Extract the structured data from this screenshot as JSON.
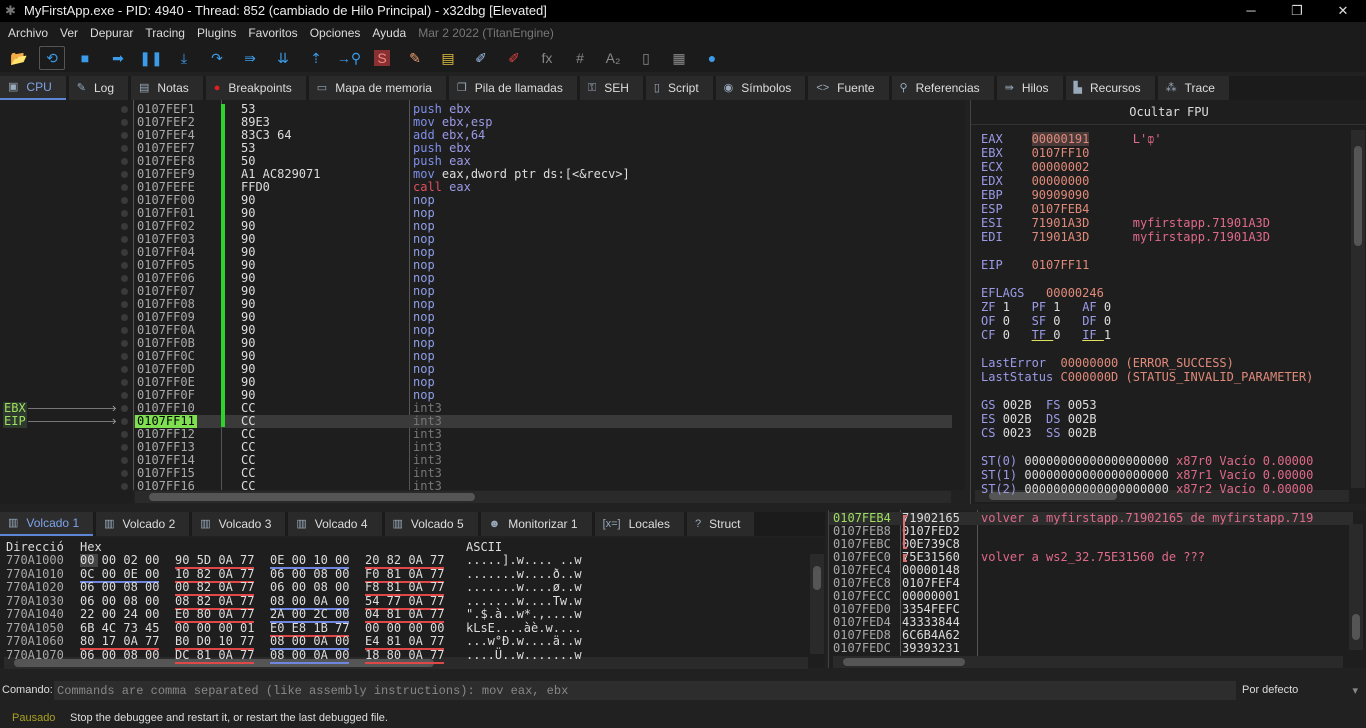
{
  "window": {
    "title": "MyFirstApp.exe - PID: 4940 - Thread: 852 (cambiado de Hilo Principal) - x32dbg [Elevated]",
    "minimize": "─",
    "maximize": "❐",
    "close": "✕"
  },
  "menu": {
    "items": [
      "Archivo",
      "Ver",
      "Depurar",
      "Tracing",
      "Plugins",
      "Favoritos",
      "Opciones",
      "Ayuda"
    ],
    "version": "Mar 2 2022 (TitanEngine)"
  },
  "toolbar": [
    {
      "icon": "open-folder-icon",
      "glyph": "📂"
    },
    {
      "icon": "restart-icon",
      "glyph": "⟲",
      "selected": true
    },
    {
      "icon": "stop-icon",
      "glyph": "■"
    },
    {
      "icon": "run-icon",
      "glyph": "➡"
    },
    {
      "icon": "pause-icon",
      "glyph": "❚❚"
    },
    {
      "icon": "step-into-icon",
      "glyph": "⤓"
    },
    {
      "icon": "step-over-icon",
      "glyph": "↷"
    },
    {
      "icon": "trace-into-icon",
      "glyph": "⇛"
    },
    {
      "icon": "trace-over-icon",
      "glyph": "⇊"
    },
    {
      "icon": "execute-till-return-icon",
      "glyph": "⇡"
    },
    {
      "icon": "run-to-user-code-icon",
      "glyph": "→⚲"
    },
    {
      "icon": "scylla-icon",
      "glyph": "S"
    },
    {
      "icon": "patch-icon",
      "glyph": "✎"
    },
    {
      "icon": "comments-icon",
      "glyph": "▤"
    },
    {
      "icon": "labels-icon",
      "glyph": "✐"
    },
    {
      "icon": "bookmarks-icon",
      "glyph": "✐"
    },
    {
      "icon": "functions-icon",
      "glyph": "fx"
    },
    {
      "icon": "hash-icon",
      "glyph": "#"
    },
    {
      "icon": "strings-icon",
      "glyph": "A₂"
    },
    {
      "icon": "device-icon",
      "glyph": "▯"
    },
    {
      "icon": "calculator-icon",
      "glyph": "▦"
    },
    {
      "icon": "globe-icon",
      "glyph": "●"
    }
  ],
  "tabs": [
    {
      "label": "CPU",
      "icon": "cpu-icon",
      "glyph": "▣",
      "active": true
    },
    {
      "label": "Log",
      "icon": "log-icon",
      "glyph": "✎"
    },
    {
      "label": "Notas",
      "icon": "notes-icon",
      "glyph": "▤"
    },
    {
      "label": "Breakpoints",
      "icon": "breakpoint-icon",
      "glyph": "●"
    },
    {
      "label": "Mapa de memoria",
      "icon": "memory-map-icon",
      "glyph": "▭"
    },
    {
      "label": "Pila de llamadas",
      "icon": "call-stack-icon",
      "glyph": "❐"
    },
    {
      "label": "SEH",
      "icon": "seh-icon",
      "glyph": "⚿"
    },
    {
      "label": "Script",
      "icon": "script-icon",
      "glyph": "▯"
    },
    {
      "label": "Símbolos",
      "icon": "symbols-icon",
      "glyph": "◉"
    },
    {
      "label": "Fuente",
      "icon": "source-icon",
      "glyph": "<>"
    },
    {
      "label": "Referencias",
      "icon": "references-icon",
      "glyph": "⚲"
    },
    {
      "label": "Hilos",
      "icon": "threads-icon",
      "glyph": "⇛"
    },
    {
      "label": "Recursos",
      "icon": "resources-icon",
      "glyph": "▙"
    },
    {
      "label": "Trace",
      "icon": "trace-icon",
      "glyph": "⁂"
    }
  ],
  "disasm": {
    "labels": [
      {
        "text": "EBX",
        "row": 23
      },
      {
        "text": "EIP",
        "row": 24
      }
    ],
    "current_row": 24,
    "rows": [
      {
        "addr": "0107FEF1",
        "bytes": "53",
        "mn": "push",
        "op": "ebx"
      },
      {
        "addr": "0107FEF2",
        "bytes": "89E3",
        "mn": "mov",
        "op": "ebx,esp"
      },
      {
        "addr": "0107FEF4",
        "bytes": "83C3 64",
        "mn": "add",
        "op": "ebx,64"
      },
      {
        "addr": "0107FEF7",
        "bytes": "53",
        "mn": "push",
        "op": "ebx"
      },
      {
        "addr": "0107FEF8",
        "bytes": "50",
        "mn": "push",
        "op": "eax"
      },
      {
        "addr": "0107FEF9",
        "bytes": "A1 AC829071",
        "mn": "mov",
        "op": "eax,dword ptr ds:[<&recv>]"
      },
      {
        "addr": "0107FEFE",
        "bytes": "FFD0",
        "mn": "call",
        "op": "eax"
      },
      {
        "addr": "0107FF00",
        "bytes": "90",
        "mn": "nop",
        "op": ""
      },
      {
        "addr": "0107FF01",
        "bytes": "90",
        "mn": "nop",
        "op": ""
      },
      {
        "addr": "0107FF02",
        "bytes": "90",
        "mn": "nop",
        "op": ""
      },
      {
        "addr": "0107FF03",
        "bytes": "90",
        "mn": "nop",
        "op": ""
      },
      {
        "addr": "0107FF04",
        "bytes": "90",
        "mn": "nop",
        "op": ""
      },
      {
        "addr": "0107FF05",
        "bytes": "90",
        "mn": "nop",
        "op": ""
      },
      {
        "addr": "0107FF06",
        "bytes": "90",
        "mn": "nop",
        "op": ""
      },
      {
        "addr": "0107FF07",
        "bytes": "90",
        "mn": "nop",
        "op": ""
      },
      {
        "addr": "0107FF08",
        "bytes": "90",
        "mn": "nop",
        "op": ""
      },
      {
        "addr": "0107FF09",
        "bytes": "90",
        "mn": "nop",
        "op": ""
      },
      {
        "addr": "0107FF0A",
        "bytes": "90",
        "mn": "nop",
        "op": ""
      },
      {
        "addr": "0107FF0B",
        "bytes": "90",
        "mn": "nop",
        "op": ""
      },
      {
        "addr": "0107FF0C",
        "bytes": "90",
        "mn": "nop",
        "op": ""
      },
      {
        "addr": "0107FF0D",
        "bytes": "90",
        "mn": "nop",
        "op": ""
      },
      {
        "addr": "0107FF0E",
        "bytes": "90",
        "mn": "nop",
        "op": ""
      },
      {
        "addr": "0107FF0F",
        "bytes": "90",
        "mn": "nop",
        "op": ""
      },
      {
        "addr": "0107FF10",
        "bytes": "CC",
        "mn": "int3",
        "op": ""
      },
      {
        "addr": "0107FF11",
        "bytes": "CC",
        "mn": "int3",
        "op": ""
      },
      {
        "addr": "0107FF12",
        "bytes": "CC",
        "mn": "int3",
        "op": ""
      },
      {
        "addr": "0107FF13",
        "bytes": "CC",
        "mn": "int3",
        "op": ""
      },
      {
        "addr": "0107FF14",
        "bytes": "CC",
        "mn": "int3",
        "op": ""
      },
      {
        "addr": "0107FF15",
        "bytes": "CC",
        "mn": "int3",
        "op": ""
      },
      {
        "addr": "0107FF16",
        "bytes": "CC",
        "mn": "int3",
        "op": ""
      }
    ]
  },
  "registers": {
    "fpu_toggle": "Ocultar FPU",
    "lines": [
      [
        [
          "EAX    ",
          "rn"
        ],
        [
          "00000191",
          "rv"
        ],
        [
          "      L'ȹ'",
          "rc"
        ]
      ],
      [
        [
          "EBX    ",
          "rn"
        ],
        [
          "0107FF10",
          "rv"
        ]
      ],
      [
        [
          "ECX    ",
          "rn"
        ],
        [
          "00000002",
          "rv"
        ]
      ],
      [
        [
          "EDX    ",
          "rn"
        ],
        [
          "00000000",
          "rv"
        ]
      ],
      [
        [
          "EBP    ",
          "rn"
        ],
        [
          "90909090",
          "rv"
        ]
      ],
      [
        [
          "ESP    ",
          "rn"
        ],
        [
          "0107FEB4",
          "rv"
        ]
      ],
      [
        [
          "ESI    ",
          "rn"
        ],
        [
          "71901A3D",
          "rv"
        ],
        [
          "      myfirstapp.71901A3D",
          "rc"
        ]
      ],
      [
        [
          "EDI    ",
          "rn"
        ],
        [
          "71901A3D",
          "rv"
        ],
        [
          "      myfirstapp.71901A3D",
          "rc"
        ]
      ],
      [],
      [
        [
          "EIP    ",
          "rn"
        ],
        [
          "0107FF11",
          "rv"
        ]
      ],
      [],
      [
        [
          "EFLAGS   ",
          "rn"
        ],
        [
          "00000246",
          "rv"
        ]
      ],
      [
        [
          "ZF ",
          "rn"
        ],
        [
          "1   ",
          "rw"
        ],
        [
          "PF ",
          "rn"
        ],
        [
          "1   ",
          "rw"
        ],
        [
          "AF ",
          "rn"
        ],
        [
          "0",
          "rw"
        ]
      ],
      [
        [
          "OF ",
          "rn"
        ],
        [
          "0   ",
          "rw"
        ],
        [
          "SF ",
          "rn"
        ],
        [
          "0   ",
          "rw"
        ],
        [
          "DF ",
          "rn"
        ],
        [
          "0",
          "rw"
        ]
      ],
      [
        [
          "CF ",
          "rn"
        ],
        [
          "0   ",
          "rw"
        ],
        [
          "TF ",
          "rn"
        ],
        [
          "0   ",
          "rw"
        ],
        [
          "IF ",
          "rn"
        ],
        [
          "1",
          "rw"
        ]
      ],
      [],
      [
        [
          "LastError  ",
          "rn"
        ],
        [
          "00000000 (ERROR_SUCCESS)",
          "rv"
        ]
      ],
      [
        [
          "LastStatus ",
          "rn"
        ],
        [
          "C000000D (STATUS_INVALID_PARAMETER)",
          "rv"
        ]
      ],
      [],
      [
        [
          "GS ",
          "rn"
        ],
        [
          "002B  ",
          "rw"
        ],
        [
          "FS ",
          "rn"
        ],
        [
          "0053",
          "rw"
        ]
      ],
      [
        [
          "ES ",
          "rn"
        ],
        [
          "002B  ",
          "rw"
        ],
        [
          "DS ",
          "rn"
        ],
        [
          "002B",
          "rw"
        ]
      ],
      [
        [
          "CS ",
          "rn"
        ],
        [
          "0023  ",
          "rw"
        ],
        [
          "SS ",
          "rn"
        ],
        [
          "002B",
          "rw"
        ]
      ],
      [],
      [
        [
          "ST(0) ",
          "rn"
        ],
        [
          "00000000000000000000 ",
          "rw"
        ],
        [
          "x87r0 Vacío 0.00000",
          "rc"
        ]
      ],
      [
        [
          "ST(1) ",
          "rn"
        ],
        [
          "00000000000000000000 ",
          "rw"
        ],
        [
          "x87r1 Vacío 0.00000",
          "rc"
        ]
      ],
      [
        [
          "ST(2) ",
          "rn"
        ],
        [
          "00000000000000000000 ",
          "rw"
        ],
        [
          "x87r2 Vacío 0.00000",
          "rc"
        ]
      ]
    ]
  },
  "bottom_tabs": [
    {
      "label": "Volcado 1",
      "icon": "dump-icon",
      "glyph": "▥",
      "active": true
    },
    {
      "label": "Volcado 2",
      "icon": "dump-icon",
      "glyph": "▥"
    },
    {
      "label": "Volcado 3",
      "icon": "dump-icon",
      "glyph": "▥"
    },
    {
      "label": "Volcado 4",
      "icon": "dump-icon",
      "glyph": "▥"
    },
    {
      "label": "Volcado 5",
      "icon": "dump-icon",
      "glyph": "▥"
    },
    {
      "label": "Monitorizar 1",
      "icon": "watch-icon",
      "glyph": "☻"
    },
    {
      "label": "Locales",
      "icon": "locals-icon",
      "glyph": "[x=]"
    },
    {
      "label": "Struct",
      "icon": "struct-icon",
      "glyph": "?"
    }
  ],
  "dump": {
    "headers": {
      "address": "Direcció",
      "hex": "Hex",
      "ascii": "ASCII"
    },
    "rows": [
      {
        "addr": "770A1000",
        "groups": [
          [
            "00 00 02 00",
            ""
          ],
          [
            "90 5D 0A 77",
            "red"
          ],
          [
            "0E 00 10 00",
            "blue"
          ],
          [
            "20 82 0A 77",
            "red"
          ]
        ],
        "ascii": ".....].w.... ..w"
      },
      {
        "addr": "770A1010",
        "groups": [
          [
            "0C 00 0E 00",
            "blue"
          ],
          [
            "10 82 0A 77",
            "red"
          ],
          [
            "06 00 08 00",
            ""
          ],
          [
            "F0 81 0A 77",
            "red"
          ]
        ],
        "ascii": ".......w....ð..w"
      },
      {
        "addr": "770A1020",
        "groups": [
          [
            "06 00 08 00",
            ""
          ],
          [
            "00 82 0A 77",
            "red"
          ],
          [
            "06 00 08 00",
            ""
          ],
          [
            "F8 81 0A 77",
            "red"
          ]
        ],
        "ascii": ".......w....ø..w"
      },
      {
        "addr": "770A1030",
        "groups": [
          [
            "06 00 08 00",
            ""
          ],
          [
            "08 82 0A 77",
            "red"
          ],
          [
            "08 00 0A 00",
            "blue"
          ],
          [
            "54 77 0A 77",
            "red"
          ]
        ],
        "ascii": ".......w....Tw.w"
      },
      {
        "addr": "770A1040",
        "groups": [
          [
            "22 00 24 00",
            ""
          ],
          [
            "E0 80 0A 77",
            "red"
          ],
          [
            "2A 00 2C 00",
            "blue"
          ],
          [
            "04 81 0A 77",
            "red"
          ]
        ],
        "ascii": "\".$.à..w*.,....w"
      },
      {
        "addr": "770A1050",
        "groups": [
          [
            "6B 4C 73 45",
            ""
          ],
          [
            "00 00 00 01",
            ""
          ],
          [
            "E0 E8 1B 77",
            "red"
          ],
          [
            "00 00 00 00",
            ""
          ]
        ],
        "ascii": "kLsE....àè.w...."
      },
      {
        "addr": "770A1060",
        "groups": [
          [
            "80 17 0A 77",
            "red"
          ],
          [
            "B0 D0 10 77",
            "red"
          ],
          [
            "08 00 0A 00",
            "blue"
          ],
          [
            "E4 81 0A 77",
            "red"
          ]
        ],
        "ascii": "...w°Đ.w....ä..w"
      },
      {
        "addr": "770A1070",
        "groups": [
          [
            "06 00 08 00",
            ""
          ],
          [
            "DC 81 0A 77",
            "red"
          ],
          [
            "08 00 0A 00",
            "blue"
          ],
          [
            "18 80 0A 77",
            "red"
          ]
        ],
        "ascii": "....Ü..w.......w"
      }
    ]
  },
  "stack": {
    "rows": [
      {
        "addr": "0107FEB4",
        "val": "71902165",
        "comment": "volver a myfirstapp.71902165 de myfirstapp.719"
      },
      {
        "addr": "0107FEB8",
        "val": "0107FED2",
        "comment": ""
      },
      {
        "addr": "0107FEBC",
        "val": "00E739C8",
        "comment": ""
      },
      {
        "addr": "0107FEC0",
        "val": "75E31560",
        "comment": "volver a ws2_32.75E31560 de ???"
      },
      {
        "addr": "0107FEC4",
        "val": "00000148",
        "comment": ""
      },
      {
        "addr": "0107FEC8",
        "val": "0107FEF4",
        "comment": ""
      },
      {
        "addr": "0107FECC",
        "val": "00000001",
        "comment": ""
      },
      {
        "addr": "0107FED0",
        "val": "3354FEFC",
        "comment": ""
      },
      {
        "addr": "0107FED4",
        "val": "43333844",
        "comment": ""
      },
      {
        "addr": "0107FED8",
        "val": "6C6B4A62",
        "comment": ""
      },
      {
        "addr": "0107FEDC",
        "val": "39393231",
        "comment": ""
      }
    ]
  },
  "command": {
    "label": "Comando:",
    "placeholder": "Commands are comma separated (like assembly instructions): mov eax, ebx",
    "value": "",
    "mode": "Por defecto"
  },
  "status": {
    "state": "Pausado",
    "message": "Stop the debuggee and restart it, or restart the last debugged file."
  },
  "colors": {
    "state": "#a8a020",
    "eip_highlight": "#7ee050",
    "mnemonic": "#7f8fe8",
    "call": "#e05060",
    "nop": "#8f9fe8",
    "int3": "#777777",
    "number": "#e08060"
  }
}
